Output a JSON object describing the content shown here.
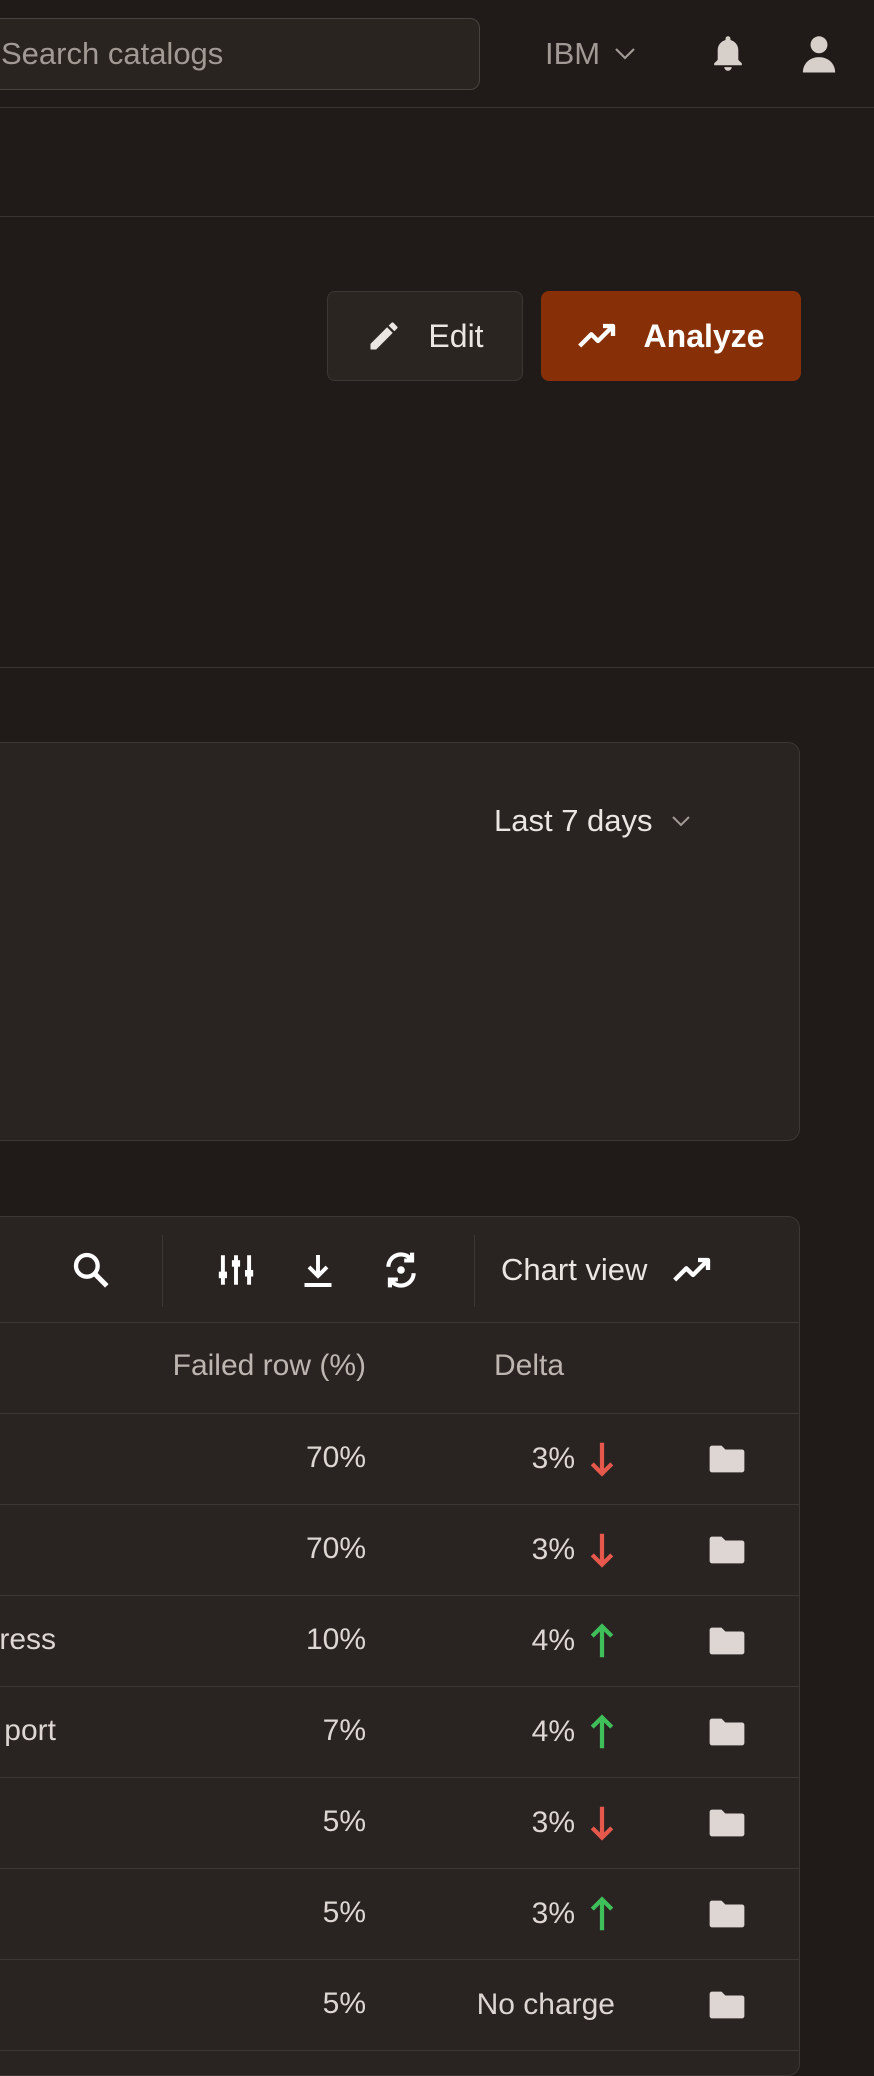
{
  "topbar": {
    "search_placeholder": "Search catalogs",
    "org_name": "IBM",
    "notifications_icon": "bell-icon",
    "profile_icon": "user-icon"
  },
  "header": {
    "edit_label": "Edit",
    "analyze_label": "Analyze",
    "accent_color": "#873007"
  },
  "summary_card": {
    "range_label": "Last 7 days"
  },
  "table": {
    "toolbar": {
      "chart_view_label": "Chart view"
    },
    "columns": {
      "failed": "Failed row (%)",
      "delta": "Delta"
    },
    "rows": [
      {
        "name": "",
        "failed": "70%",
        "delta": "3%",
        "trend": "down"
      },
      {
        "name": "",
        "failed": "70%",
        "delta": "3%",
        "trend": "down"
      },
      {
        "name": "dress",
        "failed": "10%",
        "delta": "4%",
        "trend": "up"
      },
      {
        "name": "port",
        "failed": "7%",
        "delta": "4%",
        "trend": "up"
      },
      {
        "name": "",
        "failed": "5%",
        "delta": "3%",
        "trend": "down"
      },
      {
        "name": "",
        "failed": "5%",
        "delta": "3%",
        "trend": "up"
      },
      {
        "name": "",
        "failed": "5%",
        "delta": "No charge",
        "trend": "none"
      }
    ],
    "colors": {
      "down": "#e5584b",
      "up": "#3fbf5a"
    }
  }
}
